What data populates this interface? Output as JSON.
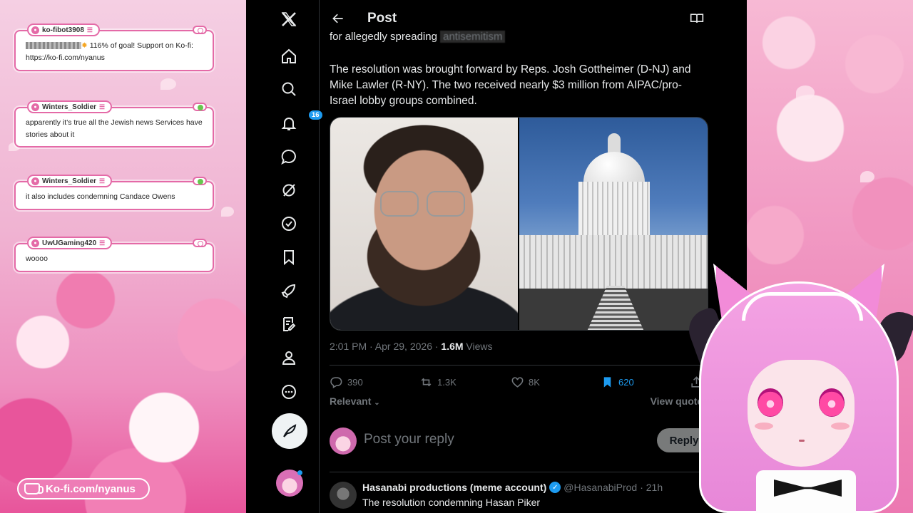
{
  "chat": {
    "messages": [
      {
        "user": "ko-fibot3908",
        "text_prefix": "",
        "text_suffix": "116% of goal! Support on Ko-fi: https://ko-fi.com/nyanus",
        "status": "default"
      },
      {
        "user": "Winters_Soldier",
        "text": "apparently it's true all the Jewish news Services have stories about it",
        "status": "green"
      },
      {
        "user": "Winters_Soldier",
        "text": "it also includes condemning Candace Owens",
        "status": "green"
      },
      {
        "user": "UwUGaming420",
        "text": "woooo",
        "status": "default"
      }
    ],
    "kofi_link": "Ko-fi.com/nyanus"
  },
  "x": {
    "nav": {
      "items": [
        "x-logo",
        "home",
        "explore",
        "notifications",
        "messages",
        "grok",
        "verified",
        "bookmarks",
        "jobs",
        "articles",
        "profile",
        "more"
      ],
      "notification_count": "16"
    },
    "header": {
      "title": "Post"
    },
    "post": {
      "clipped_line_prefix": "for allegedly spreading ",
      "clipped_line_obscured": "antisemitism",
      "body": "The resolution was brought forward by Reps. Josh Gottheimer (D-NJ) and Mike Lawler (R-NY). The two received nearly $3 million from AIPAC/pro-Israel lobby groups combined.",
      "timestamp": "2:01 PM · Apr 29, 2026 · ",
      "views_count": "1.6M",
      "views_label": " Views",
      "replies": "390",
      "reposts": "1.3K",
      "likes": "8K",
      "bookmarks": "620",
      "sort_label": "Relevant",
      "view_quotes": "View quotes"
    },
    "reply_box": {
      "placeholder": "Post your reply",
      "button": "Reply"
    },
    "next_post": {
      "name": "Hasanabi productions (meme account)",
      "handle": "@HasanabiProd",
      "time": "· 21h",
      "text": "The resolution condemning Hasan Piker"
    }
  },
  "colors": {
    "accent_blue": "#1d9bf0",
    "chat_border": "#e46aa7",
    "x_background": "#000000"
  }
}
